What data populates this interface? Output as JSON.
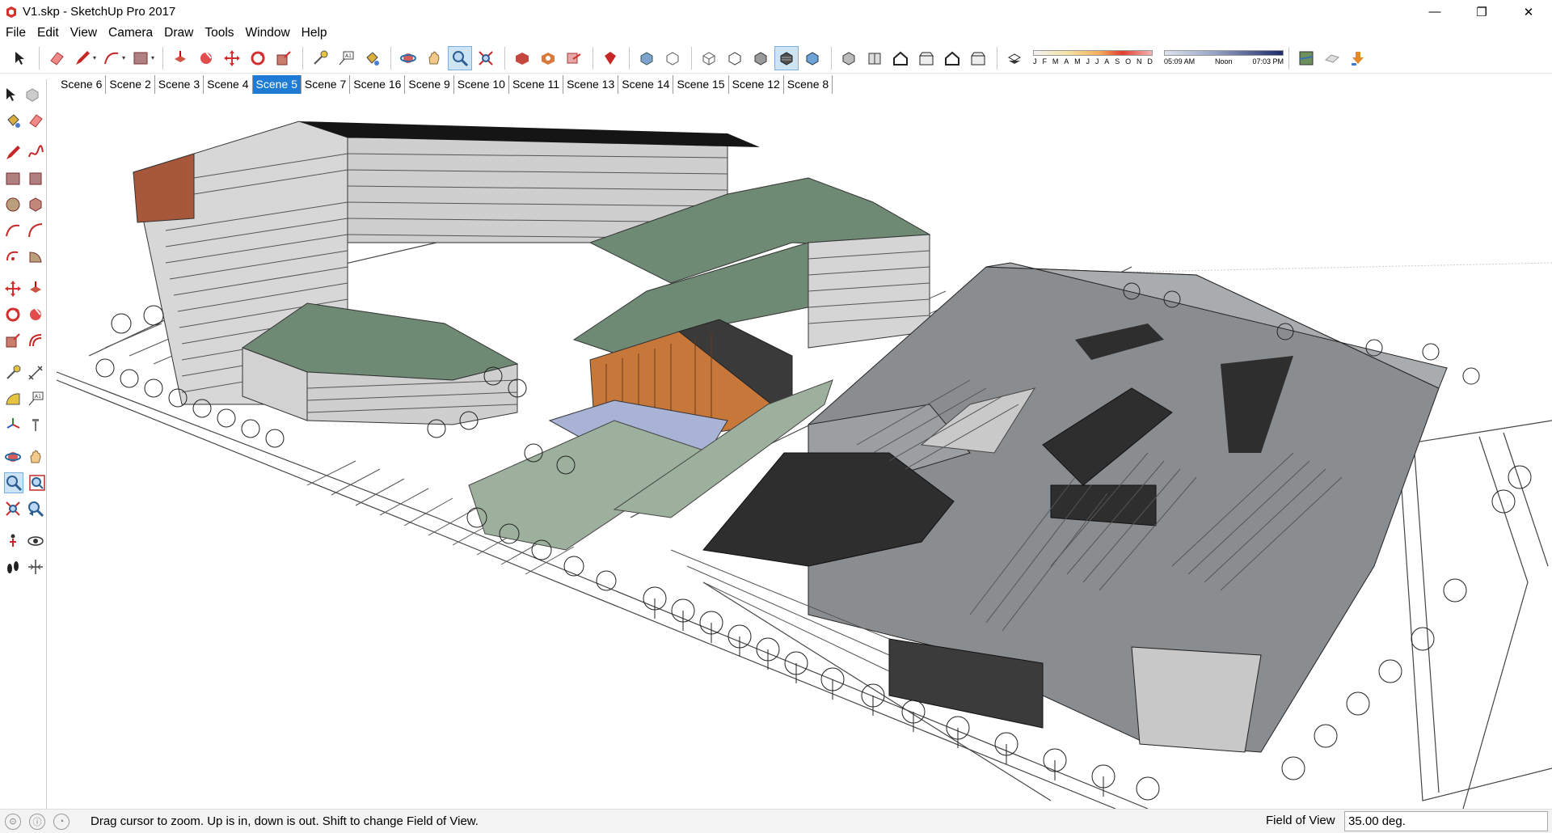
{
  "window": {
    "title": "V1.skp - SketchUp Pro 2017",
    "controls": {
      "minimize": "—",
      "maximize": "❐",
      "close": "✕"
    }
  },
  "menu": [
    "File",
    "Edit",
    "View",
    "Camera",
    "Draw",
    "Tools",
    "Window",
    "Help"
  ],
  "toolbar": {
    "shadow_months": [
      "J",
      "F",
      "M",
      "A",
      "M",
      "J",
      "J",
      "A",
      "S",
      "O",
      "N",
      "D"
    ],
    "time_start": "05:09 AM",
    "time_mid": "Noon",
    "time_end": "07:03 PM",
    "active_tool": "zoom-icon"
  },
  "scenes": {
    "tabs": [
      "Scene 6",
      "Scene 2",
      "Scene 3",
      "Scene 4",
      "Scene 5",
      "Scene 7",
      "Scene 16",
      "Scene 9",
      "Scene 10",
      "Scene 11",
      "Scene 13",
      "Scene 14",
      "Scene 15",
      "Scene 12",
      "Scene 8"
    ],
    "active": "Scene 5"
  },
  "status": {
    "message": "Drag cursor to zoom.  Up is in, down is out. Shift to change Field of View.",
    "measurement_label": "Field of View",
    "measurement_value": "35.00 deg."
  },
  "colors": {
    "roof_green": "#6f8a74",
    "facade_grey": "#c9c9c9",
    "metal_roof": "#8a8d90",
    "dark_panel": "#2e2e2e",
    "glass_orange": "#c8773a",
    "plaza_blue": "#a8b3d6",
    "accent_blue": "#1e7bd6"
  }
}
